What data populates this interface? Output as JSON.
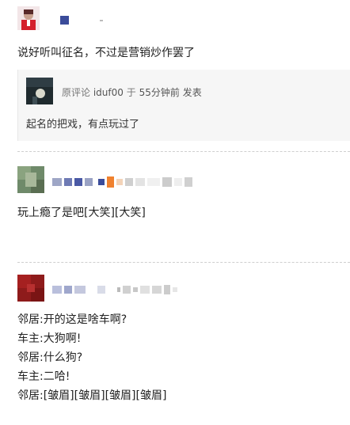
{
  "comments": [
    {
      "text": "说好听叫征名，不过是营销炒作罢了",
      "quote": {
        "source_label": "原评论",
        "user": "iduf00",
        "connector": "于",
        "time": "55分钟前",
        "action": "发表",
        "text": "起名的把戏，有点玩过了"
      }
    },
    {
      "text": "玩上瘾了是吧[大笑][大笑]"
    },
    {
      "lines": [
        "邻居:开的这是啥车啊?",
        "车主:大狗啊!",
        "邻居:什么狗?",
        "车主:二哈!",
        "邻居:[皱眉][皱眉][皱眉][皱眉]"
      ]
    }
  ]
}
